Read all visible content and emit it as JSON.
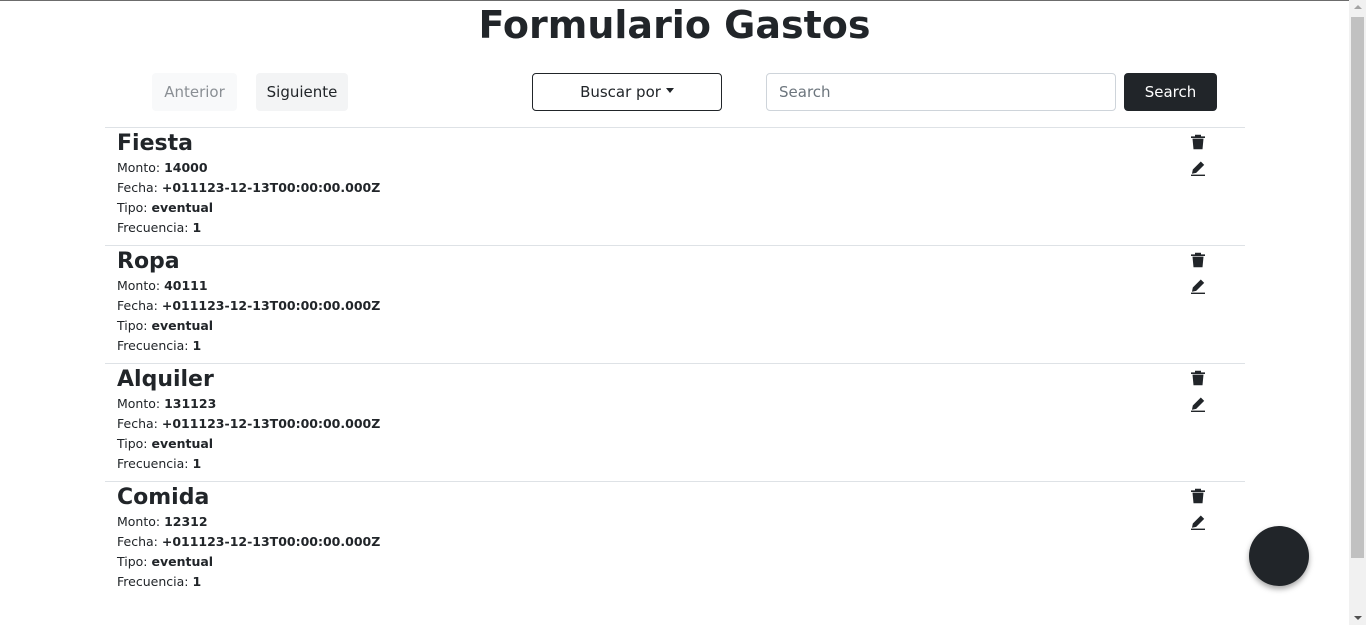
{
  "page": {
    "title": "Formulario Gastos"
  },
  "toolbar": {
    "prev_label": "Anterior",
    "next_label": "Siguiente",
    "buscar_label": "Buscar por",
    "search_placeholder": "Search",
    "search_value": "",
    "search_button_label": "Search"
  },
  "labels": {
    "monto": "Monto: ",
    "fecha": "Fecha: ",
    "tipo": "Tipo: ",
    "frecuencia": "Frecuencia: "
  },
  "items": [
    {
      "name": "Fiesta",
      "monto": "14000",
      "fecha": "+011123-12-13T00:00:00.000Z",
      "tipo": "eventual",
      "frecuencia": "1"
    },
    {
      "name": "Ropa",
      "monto": "40111",
      "fecha": "+011123-12-13T00:00:00.000Z",
      "tipo": "eventual",
      "frecuencia": "1"
    },
    {
      "name": "Alquiler",
      "monto": "131123",
      "fecha": "+011123-12-13T00:00:00.000Z",
      "tipo": "eventual",
      "frecuencia": "1"
    },
    {
      "name": "Comida",
      "monto": "12312",
      "fecha": "+011123-12-13T00:00:00.000Z",
      "tipo": "eventual",
      "frecuencia": "1"
    }
  ],
  "icons": {
    "delete": "trash-icon",
    "edit": "pencil-icon"
  },
  "colors": {
    "dark": "#212529",
    "border": "#dee2e6",
    "muted": "#8a8f94"
  }
}
